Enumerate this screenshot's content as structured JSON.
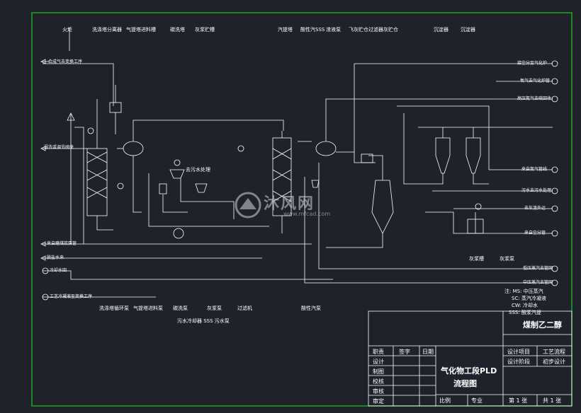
{
  "top_labels": [
    "火炬",
    "洗涤塔分离器",
    "气提塔进料槽",
    "碳洗塔",
    "灰浆贮槽",
    "汽提塔",
    "酸性汽SSS",
    "渣液泵",
    "飞灰贮仓过滤器灰贮仓",
    "沉淀器",
    "沉淀器"
  ],
  "left_inlets": [
    "合成气去变换工序",
    "湿洗或调节阀来",
    "来自磨煤浆泵管",
    "脱盐水来",
    "冷却水回",
    "工艺冷凝液至变换工序"
  ],
  "right_outlets": [
    "接空分至气化炉",
    "氧气去气化炉管",
    "高压氮气去硫回收",
    "来自氮气管线",
    "污水去污水处理",
    "去灰渣外运",
    "来自空分管"
  ],
  "process_labels": {
    "wastewater": "去污水处理",
    "bottom_row": [
      "洗涤塔循环泵",
      "气提塔进料泵",
      "碳洗泵",
      "灰浆泵",
      "过滤机",
      "酸性汽泵"
    ],
    "bottom_row2": "污水冷却器 SSS 污水泵",
    "right_mid": [
      "灰浆槽",
      "灰浆泵"
    ],
    "right_low": [
      "低压蒸汽去管网",
      "中压蒸汽去管网"
    ]
  },
  "notes": [
    "注: MS: 中压蒸汽",
    "SC: 蒸汽冷凝液",
    "CW: 冷却水",
    "SSS: 酸浆汽提"
  ],
  "title_block": {
    "project": "煤制乙二醇",
    "drawing_title_1": "气化物工段PLD",
    "drawing_title_2": "流程图",
    "left_rows": [
      "职责",
      "设计",
      "制图",
      "校核",
      "审核",
      "审定"
    ],
    "col_sign": "签字",
    "col_date": "日期",
    "design_item_label": "设计项目",
    "design_item_value": "工艺流程",
    "design_stage_label": "设计阶段",
    "design_stage_value": "初步设计",
    "scale_label": "比例",
    "specialty_label": "专业",
    "sheet": "第 1 张",
    "total": "共 1 张"
  },
  "watermark": {
    "brand": "沐风网",
    "url": "www.mfcad.com"
  },
  "colors": {
    "background": "#1f222b",
    "frame": "#1fa81f",
    "lines": "#ffffff",
    "accent": "#2ad0ff"
  }
}
